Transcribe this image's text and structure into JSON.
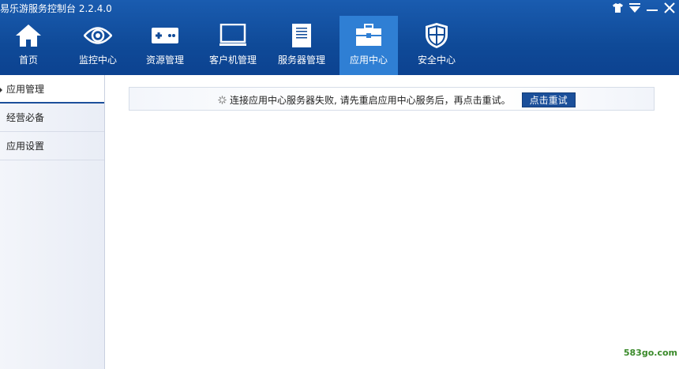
{
  "window": {
    "title": "易乐游服务控制台 2.2.4.0",
    "controls": [
      "shirt-icon",
      "menu-down-icon",
      "minimize-icon",
      "close-icon"
    ]
  },
  "nav": {
    "items": [
      {
        "label": "首页",
        "icon": "home-icon"
      },
      {
        "label": "监控中心",
        "icon": "eye-icon"
      },
      {
        "label": "资源管理",
        "icon": "gamepad-icon"
      },
      {
        "label": "客户机管理",
        "icon": "monitor-icon"
      },
      {
        "label": "服务器管理",
        "icon": "server-icon"
      },
      {
        "label": "应用中心",
        "icon": "toolbox-icon",
        "active": true
      },
      {
        "label": "安全中心",
        "icon": "shield-icon"
      }
    ]
  },
  "sidebar": {
    "items": [
      {
        "label": "应用管理",
        "active": true
      },
      {
        "label": "经营必备"
      },
      {
        "label": "应用设置"
      }
    ]
  },
  "notice": {
    "message": "连接应用中心服务器失败, 请先重启应用中心服务后，再点击重试。",
    "retry_label": "点击重试"
  },
  "watermark": "583go.com",
  "colors": {
    "header": "#0f4a98",
    "active_tab": "#2f7fd4",
    "retry_button": "#1b4f9a"
  }
}
